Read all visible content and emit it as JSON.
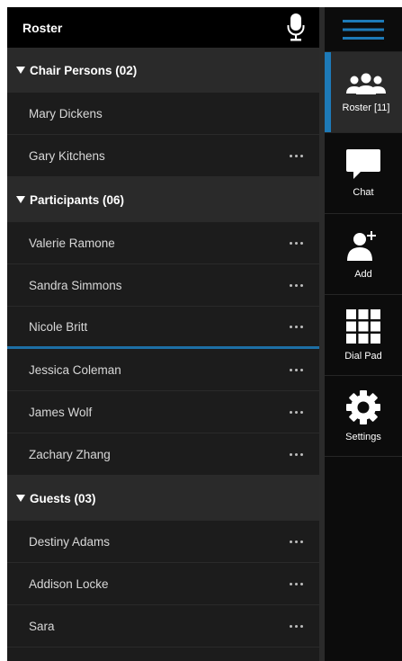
{
  "colors": {
    "accent": "#1d7ab8",
    "selected_divider": "#1d6fa5",
    "header_bg": "#000000",
    "group_bg": "#2a2a2a",
    "row_bg": "#1c1c1c"
  },
  "header": {
    "title": "Roster",
    "mic_icon": "microphone-icon"
  },
  "groups": [
    {
      "label": "Chair Persons (02)",
      "members": [
        {
          "name": "Mary Dickens",
          "has_more": false
        },
        {
          "name": "Gary Kitchens",
          "has_more": true
        }
      ]
    },
    {
      "label": "Participants (06)",
      "members": [
        {
          "name": "Valerie Ramone",
          "has_more": true
        },
        {
          "name": "Sandra Simmons",
          "has_more": true
        },
        {
          "name": "Nicole Britt",
          "has_more": true,
          "selected": true
        },
        {
          "name": "Jessica Coleman",
          "has_more": true
        },
        {
          "name": "James Wolf",
          "has_more": true
        },
        {
          "name": "Zachary Zhang",
          "has_more": true
        }
      ]
    },
    {
      "label": "Guests (03)",
      "members": [
        {
          "name": "Destiny Adams",
          "has_more": true
        },
        {
          "name": "Addison Locke",
          "has_more": true
        },
        {
          "name": "Sara",
          "has_more": true
        }
      ]
    }
  ],
  "nav": {
    "menu_icon": "hamburger-menu-icon",
    "items": [
      {
        "label": "Roster [11]",
        "icon": "people-icon",
        "active": true
      },
      {
        "label": "Chat",
        "icon": "chat-icon",
        "active": false
      },
      {
        "label": "Add",
        "icon": "add-user-icon",
        "active": false
      },
      {
        "label": "Dial Pad",
        "icon": "dialpad-icon",
        "active": false
      },
      {
        "label": "Settings",
        "icon": "gear-icon",
        "active": false
      }
    ]
  }
}
